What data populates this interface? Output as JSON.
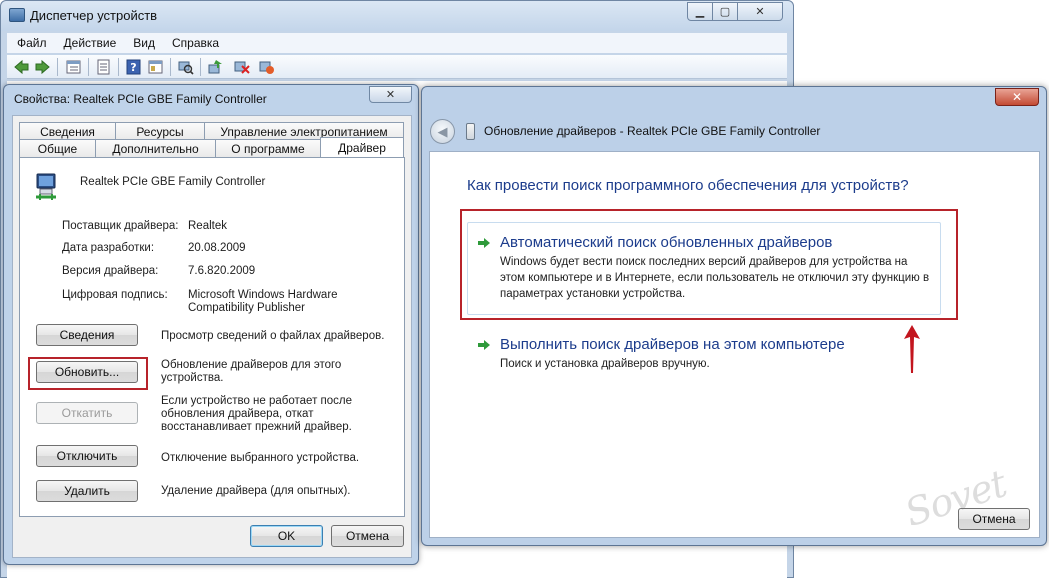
{
  "device_manager": {
    "title": "Диспетчер устройств",
    "menu": [
      "Файл",
      "Действие",
      "Вид",
      "Справка"
    ],
    "toolbar_icons": [
      "back-icon",
      "forward-icon",
      "view-icon",
      "properties-icon",
      "help-icon",
      "console-icon",
      "scan-hardware-icon",
      "update-driver-icon",
      "disable-icon",
      "uninstall-icon"
    ]
  },
  "properties_dialog": {
    "title": "Свойства: Realtek PCIe GBE Family Controller",
    "close_glyph": "✕",
    "tabs_row1": [
      "Сведения",
      "Ресурсы",
      "Управление электропитанием"
    ],
    "tabs_row2": [
      "Общие",
      "Дополнительно",
      "О программе",
      "Драйвер"
    ],
    "active_tab": "Драйвер",
    "device_name": "Realtek PCIe GBE Family Controller",
    "fields": [
      {
        "label": "Поставщик драйвера:",
        "value": "Realtek"
      },
      {
        "label": "Дата разработки:",
        "value": "20.08.2009"
      },
      {
        "label": "Версия драйвера:",
        "value": "7.6.820.2009"
      },
      {
        "label": "Цифровая подпись:",
        "value": "Microsoft Windows Hardware Compatibility Publisher"
      }
    ],
    "actions": [
      {
        "button": "Сведения",
        "desc": "Просмотр сведений о файлах драйверов.",
        "enabled": true
      },
      {
        "button": "Обновить...",
        "desc": "Обновление драйверов для этого устройства.",
        "enabled": true
      },
      {
        "button": "Откатить",
        "desc": "Если устройство не работает после обновления драйвера, откат восстанавливает прежний драйвер.",
        "enabled": false
      },
      {
        "button": "Отключить",
        "desc": "Отключение выбранного устройства.",
        "enabled": true
      },
      {
        "button": "Удалить",
        "desc": "Удаление драйвера (для опытных).",
        "enabled": true
      }
    ],
    "ok_label": "OK",
    "cancel_label": "Отмена"
  },
  "update_wizard": {
    "header": "Обновление драйверов - Realtek PCIe GBE Family Controller",
    "close_glyph": "✕",
    "back_glyph": "◀",
    "question": "Как провести поиск программного обеспечения для устройств?",
    "options": [
      {
        "title": "Автоматический поиск обновленных драйверов",
        "desc": "Windows будет вести поиск последних версий драйверов для устройства на этом компьютере и в Интернете, если пользователь не отключил эту функцию в параметрах установки устройства."
      },
      {
        "title": "Выполнить поиск драйверов на этом компьютере",
        "desc": "Поиск и установка драйверов вручную."
      }
    ],
    "cancel_label": "Отмена"
  },
  "colors": {
    "highlight": "#b7232a",
    "link_blue": "#1c3c8c",
    "arrow_green": "#2e9a3a"
  }
}
